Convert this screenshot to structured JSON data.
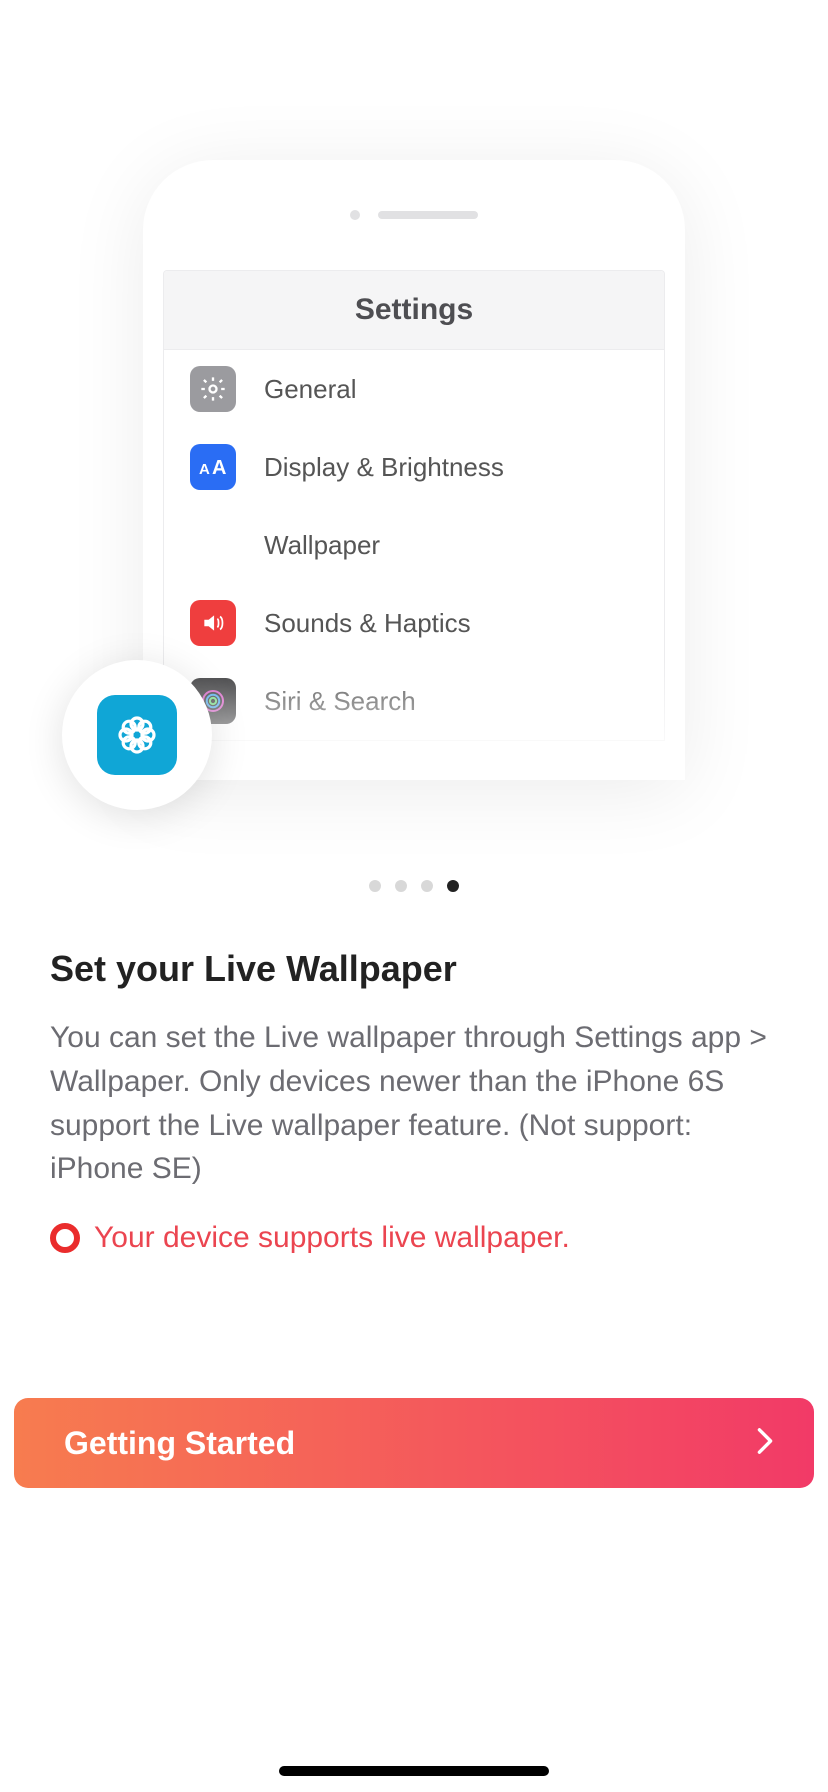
{
  "illustration": {
    "header": "Settings",
    "rows": {
      "general": "General",
      "display": "Display & Brightness",
      "wallpaper": "Wallpaper",
      "sounds": "Sounds & Haptics",
      "siri": "Siri & Search"
    }
  },
  "pager": {
    "count": 4,
    "active_index": 3
  },
  "content": {
    "title": "Set your Live Wallpaper",
    "description": "You can set the Live wallpaper through Settings app > Wallpaper. Only devices newer than the iPhone 6S support the Live wallpaper feature. (Not support: iPhone SE)",
    "support_text": "Your device supports live wallpaper."
  },
  "cta": {
    "label": "Getting Started"
  }
}
